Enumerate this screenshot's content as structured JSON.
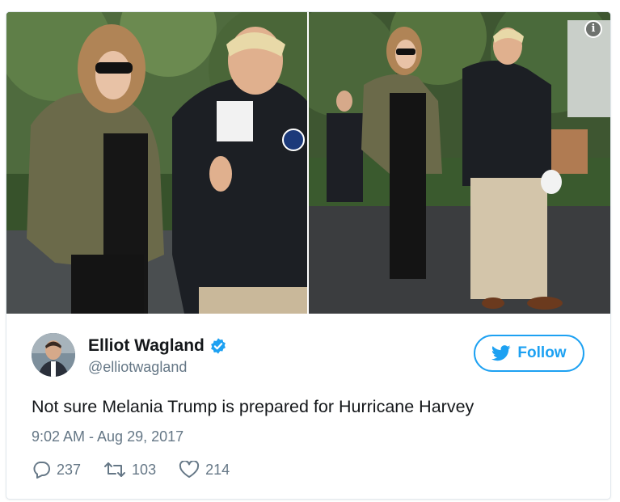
{
  "media": {
    "info_icon": "info-icon"
  },
  "tweet": {
    "author_name": "Elliot Wagland",
    "handle": "@elliotwagland",
    "verified_icon": "verified-badge-icon",
    "follow_label": "Follow",
    "follow_icon": "twitter-bird-icon",
    "text": "Not sure Melania Trump is prepared for Hurricane Harvey",
    "timestamp": "9:02 AM - Aug 29, 2017",
    "replies": "237",
    "retweets": "103",
    "likes": "214"
  },
  "colors": {
    "accent": "#1da1f2",
    "text": "#14171a",
    "muted": "#657786",
    "border": "#e1e8ed"
  }
}
